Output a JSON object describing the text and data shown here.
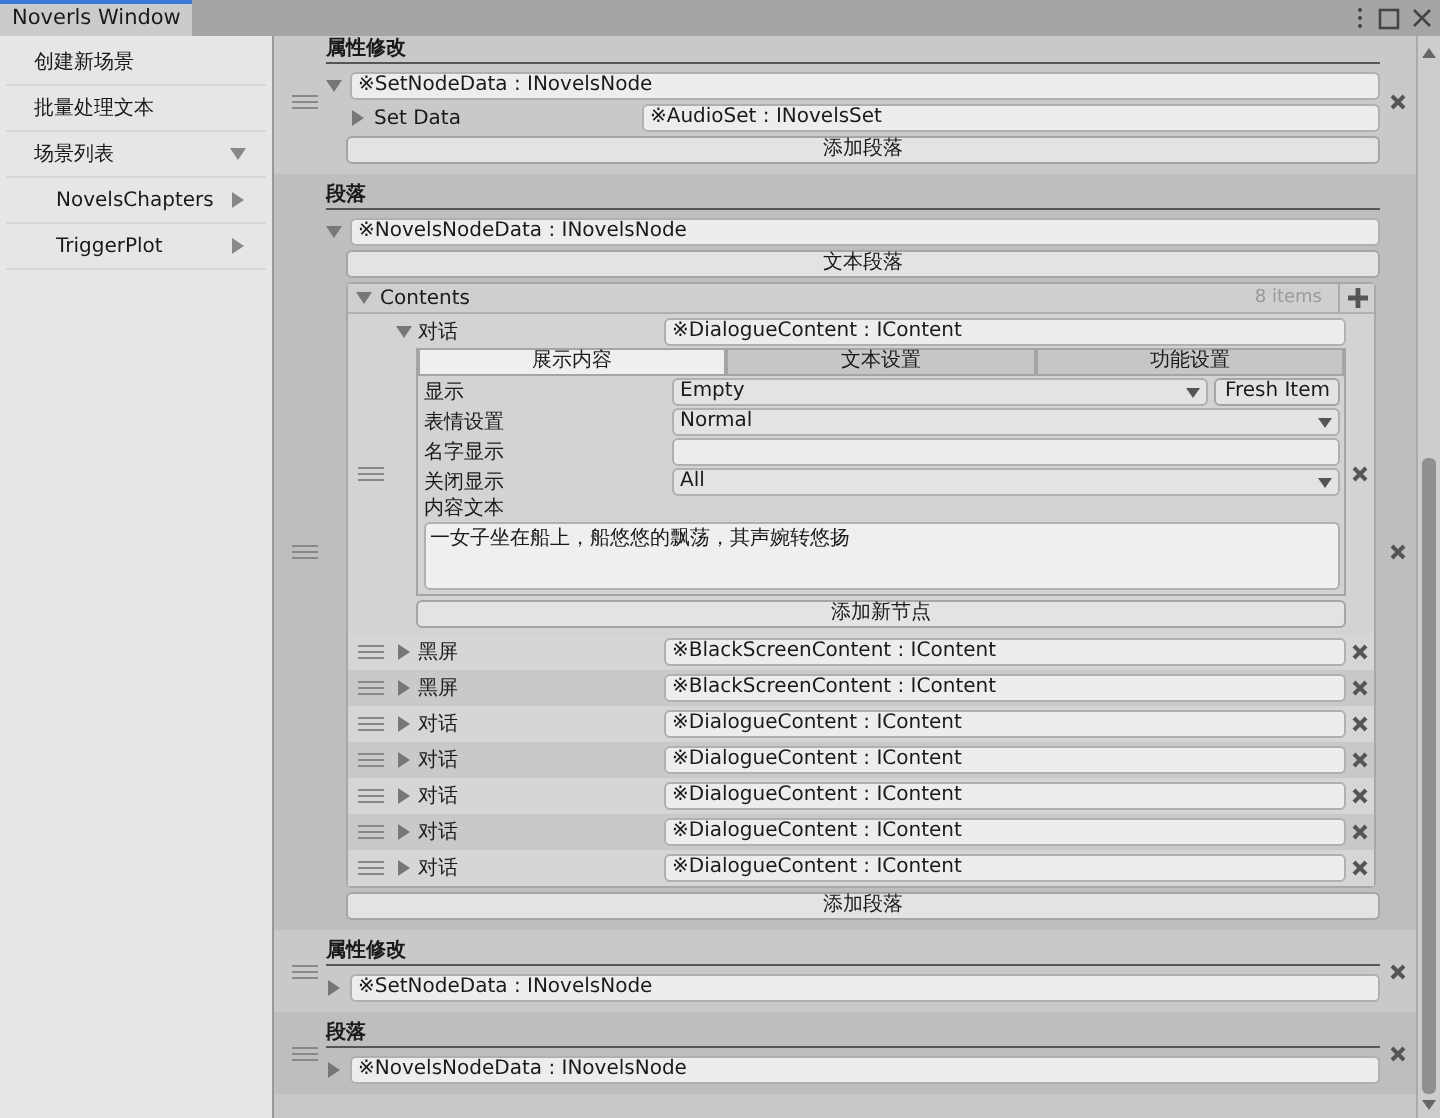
{
  "window": {
    "tab": "Noverls Window"
  },
  "sidebar": {
    "items": [
      {
        "kind": "action",
        "label": "创建新场景"
      },
      {
        "kind": "action",
        "label": "批量处理文本"
      },
      {
        "kind": "folder",
        "label": "场景列表",
        "expanded": true,
        "children": [
          {
            "kind": "folder",
            "label": "NovelsChapters",
            "expanded": false
          },
          {
            "kind": "folder",
            "label": "TriggerPlot",
            "expanded": false
          }
        ]
      }
    ]
  },
  "nodes": [
    {
      "kind": "set",
      "title": "属性修改",
      "expanded": true,
      "field": "※SetNodeData : INovelsNode",
      "properties": [
        {
          "label": "Set Data",
          "expanded": false,
          "value": "※AudioSet : INovelsSet"
        }
      ],
      "button": "添加段落"
    },
    {
      "kind": "paragraph",
      "title": "段落",
      "expanded": true,
      "field": "※NovelsNodeData : INovelsNode",
      "button_top": "文本段落",
      "contents": {
        "label": "Contents",
        "expanded": true,
        "count": "8 items",
        "items": [
          {
            "label": "对话",
            "expanded": true,
            "value": "※DialogueContent : IContent",
            "tabs": [
              {
                "label": "展示内容",
                "selected": true
              },
              {
                "label": "文本设置",
                "selected": false
              },
              {
                "label": "功能设置",
                "selected": false
              }
            ],
            "fields": [
              {
                "kind": "dropdown",
                "label": "显示",
                "value": "Empty",
                "button": "Fresh Item"
              },
              {
                "kind": "dropdown",
                "label": "表情设置",
                "value": "Normal"
              },
              {
                "kind": "text",
                "label": "名字显示"
              },
              {
                "kind": "dropdown",
                "label": "关闭显示",
                "value": "All"
              },
              {
                "kind": "textarea",
                "label": "内容文本",
                "value": "一女子坐在船上，船悠悠的飘荡，其声婉转悠扬"
              }
            ],
            "button": "添加新节点"
          },
          {
            "label": "黑屏",
            "expanded": false,
            "value": "※BlackScreenContent : IContent"
          },
          {
            "label": "黑屏",
            "expanded": false,
            "value": "※BlackScreenContent : IContent"
          },
          {
            "label": "对话",
            "expanded": false,
            "value": "※DialogueContent : IContent"
          },
          {
            "label": "对话",
            "expanded": false,
            "value": "※DialogueContent : IContent"
          },
          {
            "label": "对话",
            "expanded": false,
            "value": "※DialogueContent : IContent"
          },
          {
            "label": "对话",
            "expanded": false,
            "value": "※DialogueContent : IContent"
          },
          {
            "label": "对话",
            "expanded": false,
            "value": "※DialogueContent : IContent"
          }
        ]
      },
      "button": "添加段落"
    },
    {
      "kind": "set",
      "title": "属性修改",
      "expanded": false,
      "field": "※SetNodeData : INovelsNode"
    },
    {
      "kind": "paragraph",
      "title": "段落",
      "expanded": false,
      "field": "※NovelsNodeData : INovelsNode"
    }
  ]
}
